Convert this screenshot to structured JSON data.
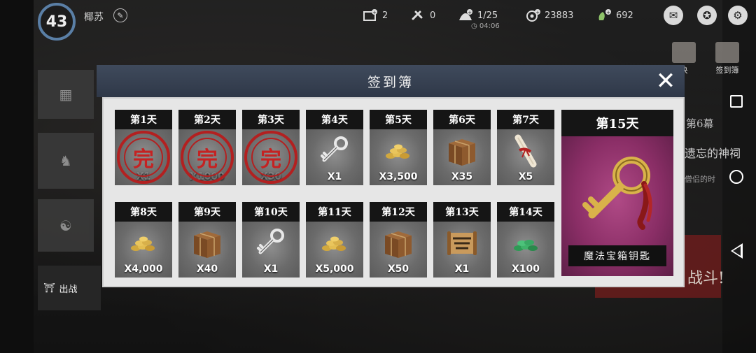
{
  "player": {
    "level": "43",
    "name": "椰苏"
  },
  "stats": {
    "flags": "2",
    "tools": "0",
    "team": "1/25",
    "timer": "04:06",
    "coins": "23883",
    "gems": "692"
  },
  "side": {
    "item_a_label": "决",
    "item_b_label": "签到簿",
    "chapter": "第6幕",
    "shrine_title": "遗忘的神祠",
    "shrine_sub": "僧侣的时",
    "fight_label": "战斗!",
    "depart_label": "出战"
  },
  "modal": {
    "title": "签到簿",
    "close_label": "✕",
    "days": [
      {
        "label": "第1天",
        "qty": "X1",
        "claimed": true,
        "item": "stamp"
      },
      {
        "label": "第2天",
        "qty": "X1000",
        "claimed": true,
        "item": "stamp"
      },
      {
        "label": "第3天",
        "qty": "X30",
        "claimed": true,
        "item": "stamp"
      },
      {
        "label": "第4天",
        "qty": "X1",
        "claimed": false,
        "item": "key-icon"
      },
      {
        "label": "第5天",
        "qty": "X3,500",
        "claimed": false,
        "item": "coins-icon"
      },
      {
        "label": "第6天",
        "qty": "X35",
        "claimed": false,
        "item": "crate-icon"
      },
      {
        "label": "第7天",
        "qty": "X5",
        "claimed": false,
        "item": "scroll-icon"
      },
      {
        "label": "第8天",
        "qty": "X4,000",
        "claimed": false,
        "item": "coins-icon"
      },
      {
        "label": "第9天",
        "qty": "X40",
        "claimed": false,
        "item": "crate-icon"
      },
      {
        "label": "第10天",
        "qty": "X1",
        "claimed": false,
        "item": "key-icon"
      },
      {
        "label": "第11天",
        "qty": "X5,000",
        "claimed": false,
        "item": "coins-icon"
      },
      {
        "label": "第12天",
        "qty": "X50",
        "claimed": false,
        "item": "crate-icon"
      },
      {
        "label": "第13天",
        "qty": "X1",
        "claimed": false,
        "item": "map-icon"
      },
      {
        "label": "第14天",
        "qty": "X100",
        "claimed": false,
        "item": "jade-coins-icon"
      }
    ],
    "stamp_char": "完",
    "grand_prize": {
      "label": "第15天",
      "name": "魔法宝箱钥匙",
      "item": "golden-key-icon"
    }
  },
  "colors": {
    "header": "#2f3848",
    "stamp": "#b32020",
    "grand_bg": "#8a2e66"
  }
}
